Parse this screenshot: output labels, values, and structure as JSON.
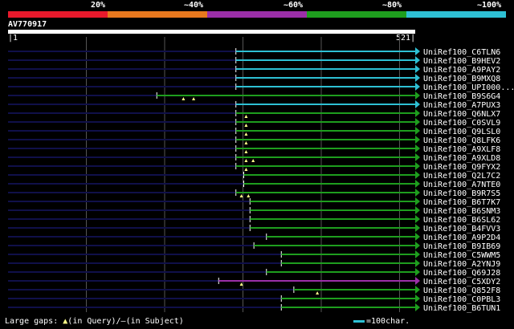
{
  "legend": {
    "labels": [
      "20%",
      "~40%",
      "~60%",
      "~80%",
      "~100%"
    ],
    "colors": [
      "#e8192c",
      "#e8781e",
      "#9b2fa8",
      "#1e9e1e",
      "#2ec0d4"
    ]
  },
  "query": {
    "title": "AV770917",
    "start": "1",
    "end": "521",
    "length": 521
  },
  "colors": {
    "background": "#000000",
    "query_line": "#10104a",
    "grid": "#555555",
    "gap_marker": "#ffff88"
  },
  "hits": [
    {
      "name": "UniRef100_C6TLN6",
      "q_start": 292,
      "q_end": 521,
      "color": "#2ec0d4",
      "gaps": []
    },
    {
      "name": "UniRef100_B9HEV2",
      "q_start": 292,
      "q_end": 521,
      "color": "#2ec0d4",
      "gaps": []
    },
    {
      "name": "UniRef100_A9PAY2",
      "q_start": 292,
      "q_end": 521,
      "color": "#2ec0d4",
      "gaps": []
    },
    {
      "name": "UniRef100_B9MXQ8",
      "q_start": 292,
      "q_end": 521,
      "color": "#2ec0d4",
      "gaps": []
    },
    {
      "name": "UniRef100_UPI000...",
      "q_start": 292,
      "q_end": 521,
      "color": "#2ec0d4",
      "gaps": []
    },
    {
      "name": "UniRef100_B9S6G4",
      "q_start": 191,
      "q_end": 521,
      "color": "#1e9e1e",
      "gaps": [
        225,
        238
      ]
    },
    {
      "name": "UniRef100_A7PUX3",
      "q_start": 292,
      "q_end": 521,
      "color": "#2ec0d4",
      "gaps": []
    },
    {
      "name": "UniRef100_Q6NLX7",
      "q_start": 292,
      "q_end": 521,
      "color": "#1e9e1e",
      "gaps": [
        305
      ]
    },
    {
      "name": "UniRef100_C0SVL9",
      "q_start": 292,
      "q_end": 521,
      "color": "#1e9e1e",
      "gaps": [
        305
      ]
    },
    {
      "name": "UniRef100_Q9LSL0",
      "q_start": 292,
      "q_end": 521,
      "color": "#1e9e1e",
      "gaps": [
        305
      ]
    },
    {
      "name": "UniRef100_Q8LFK6",
      "q_start": 292,
      "q_end": 521,
      "color": "#1e9e1e",
      "gaps": [
        305
      ]
    },
    {
      "name": "UniRef100_A9XLF8",
      "q_start": 292,
      "q_end": 521,
      "color": "#1e9e1e",
      "gaps": [
        305
      ]
    },
    {
      "name": "UniRef100_A9XLD8",
      "q_start": 292,
      "q_end": 521,
      "color": "#1e9e1e",
      "gaps": [
        305,
        314
      ]
    },
    {
      "name": "UniRef100_Q9FYX2",
      "q_start": 292,
      "q_end": 521,
      "color": "#1e9e1e",
      "gaps": [
        305
      ]
    },
    {
      "name": "UniRef100_Q2L7C2",
      "q_start": 302,
      "q_end": 521,
      "color": "#1e9e1e",
      "gaps": []
    },
    {
      "name": "UniRef100_A7NTE0",
      "q_start": 302,
      "q_end": 521,
      "color": "#1e9e1e",
      "gaps": []
    },
    {
      "name": "UniRef100_B9R7S5",
      "q_start": 292,
      "q_end": 521,
      "color": "#1e9e1e",
      "gaps": [
        299,
        308
      ]
    },
    {
      "name": "UniRef100_B6T7K7",
      "q_start": 310,
      "q_end": 521,
      "color": "#1e9e1e",
      "gaps": []
    },
    {
      "name": "UniRef100_B6SNM3",
      "q_start": 310,
      "q_end": 521,
      "color": "#1e9e1e",
      "gaps": []
    },
    {
      "name": "UniRef100_B6SL62",
      "q_start": 310,
      "q_end": 521,
      "color": "#1e9e1e",
      "gaps": []
    },
    {
      "name": "UniRef100_B4FVV3",
      "q_start": 310,
      "q_end": 521,
      "color": "#1e9e1e",
      "gaps": []
    },
    {
      "name": "UniRef100_A9P2D4",
      "q_start": 331,
      "q_end": 521,
      "color": "#1e9e1e",
      "gaps": []
    },
    {
      "name": "UniRef100_B9IB69",
      "q_start": 315,
      "q_end": 521,
      "color": "#1e9e1e",
      "gaps": []
    },
    {
      "name": "UniRef100_C5WWM5",
      "q_start": 350,
      "q_end": 521,
      "color": "#1e9e1e",
      "gaps": []
    },
    {
      "name": "UniRef100_A2YNJ9",
      "q_start": 350,
      "q_end": 521,
      "color": "#1e9e1e",
      "gaps": []
    },
    {
      "name": "UniRef100_Q69J28",
      "q_start": 331,
      "q_end": 521,
      "color": "#1e9e1e",
      "gaps": []
    },
    {
      "name": "UniRef100_C5XDY2",
      "q_start": 270,
      "q_end": 521,
      "color": "#9b2fa8",
      "gaps": [
        299
      ]
    },
    {
      "name": "UniRef100_Q852F8",
      "q_start": 366,
      "q_end": 521,
      "color": "#1e9e1e",
      "gaps": [
        396
      ]
    },
    {
      "name": "UniRef100_C0PBL3",
      "q_start": 350,
      "q_end": 521,
      "color": "#1e9e1e",
      "gaps": []
    },
    {
      "name": "UniRef100_B6TUN1",
      "q_start": 350,
      "q_end": 521,
      "color": "#1e9e1e",
      "gaps": []
    }
  ],
  "footer": {
    "large_gaps_label": "Large gaps:",
    "in_query_text": "(in Query)/",
    "dash": "–",
    "in_subject_text": "(in Subject)",
    "scale_text": "=100char."
  }
}
